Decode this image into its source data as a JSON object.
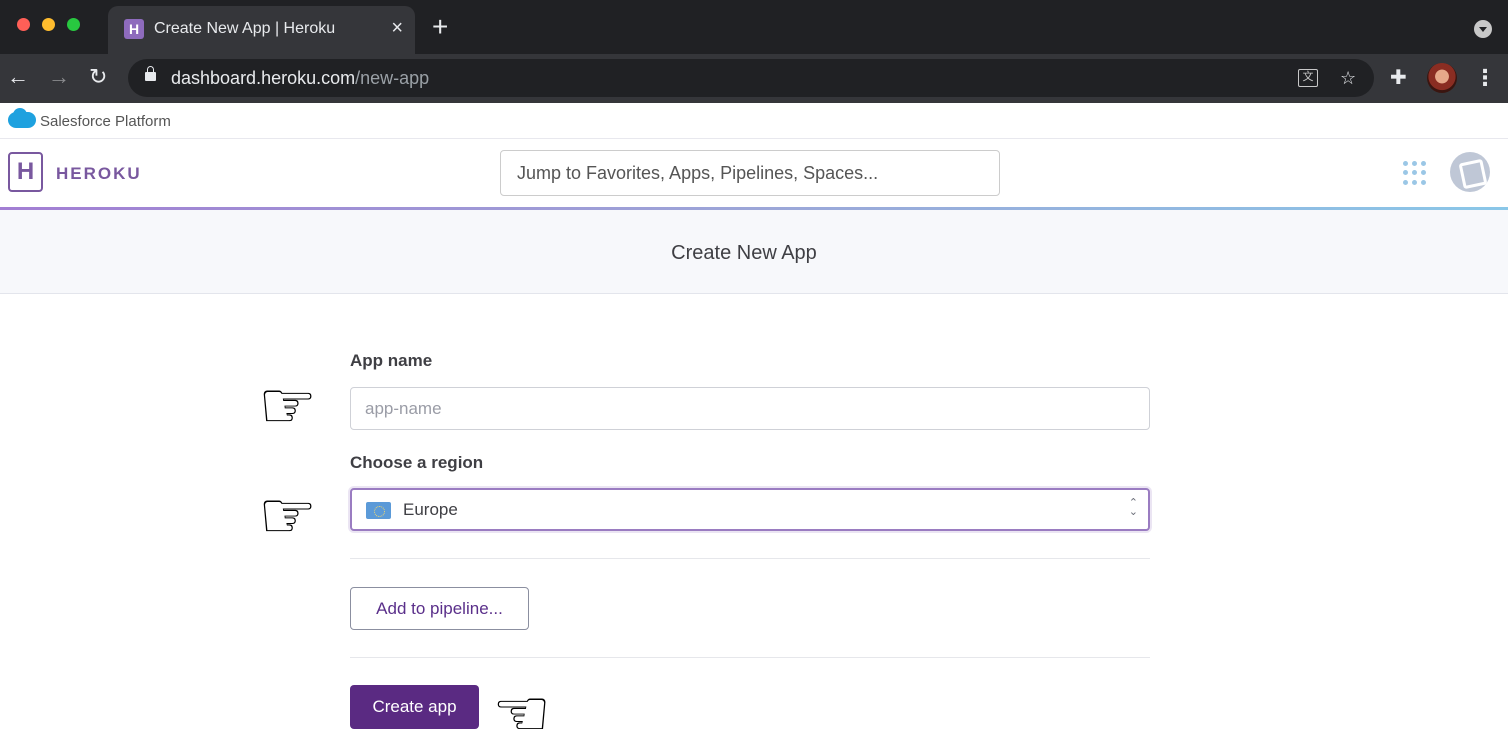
{
  "browser": {
    "tab_title": "Create New App | Heroku",
    "tab_close": "×",
    "new_tab": "+",
    "url_host": "dashboard.heroku.com",
    "url_path": "/new-app"
  },
  "salesforce": {
    "label": "Salesforce Platform"
  },
  "header": {
    "logo_letter": "H",
    "wordmark": "HEROKU",
    "search_placeholder": "Jump to Favorites, Apps, Pipelines, Spaces..."
  },
  "page": {
    "title": "Create New App"
  },
  "form": {
    "app_name_label": "App name",
    "app_name_placeholder": "app-name",
    "app_name_value": "",
    "region_label": "Choose a region",
    "region_value": "Europe",
    "pipeline_button": "Add to pipeline...",
    "create_button": "Create app"
  },
  "colors": {
    "accent": "#79589f",
    "create_button": "#5a2a82",
    "focus_border": "#9a7cc1"
  },
  "icons": {
    "annotation_hand": "☞",
    "annotation_hand_left": "☜"
  }
}
